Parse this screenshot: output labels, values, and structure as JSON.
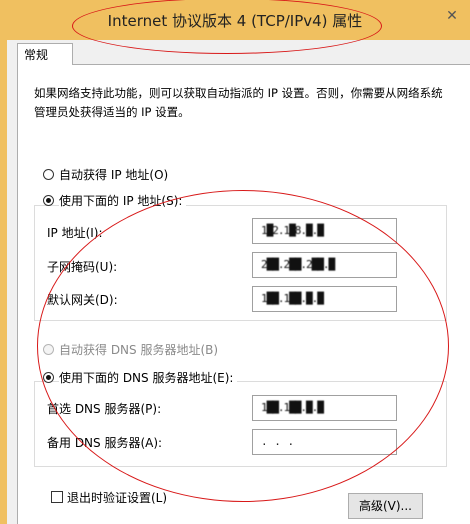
{
  "window": {
    "title": "Internet 协议版本 4 (TCP/IPv4) 属性",
    "close_glyph": "✕"
  },
  "tabs": [
    {
      "label": "常规"
    }
  ],
  "description": "如果网络支持此功能，则可以获取自动指派的 IP 设置。否则，你需要从网络系统管理员处获得适当的 IP 设置。",
  "ip": {
    "auto_label": "自动获得 IP 地址(O)",
    "manual_label": "使用下面的 IP 地址(S):",
    "selected": "manual",
    "fields": [
      {
        "label": "IP 地址(I):",
        "value": "1█2.1█8.█.█"
      },
      {
        "label": "子网掩码(U):",
        "value": "2██.2██.2██.█"
      },
      {
        "label": "默认网关(D):",
        "value": "1██.1██.█.█"
      }
    ]
  },
  "dns": {
    "auto_label": "自动获得 DNS 服务器地址(B)",
    "manual_label": "使用下面的 DNS 服务器地址(E):",
    "selected": "manual",
    "preferred_label": "首选 DNS 服务器(P):",
    "preferred_value": "1██.1██.█.█",
    "alternate_label": "备用 DNS 服务器(A):",
    "alternate_value": ".     .     ."
  },
  "footer": {
    "validate_label": "退出时验证设置(L)",
    "advanced_label": "高级(V)..."
  },
  "annotation": {
    "color": "#d81818"
  }
}
